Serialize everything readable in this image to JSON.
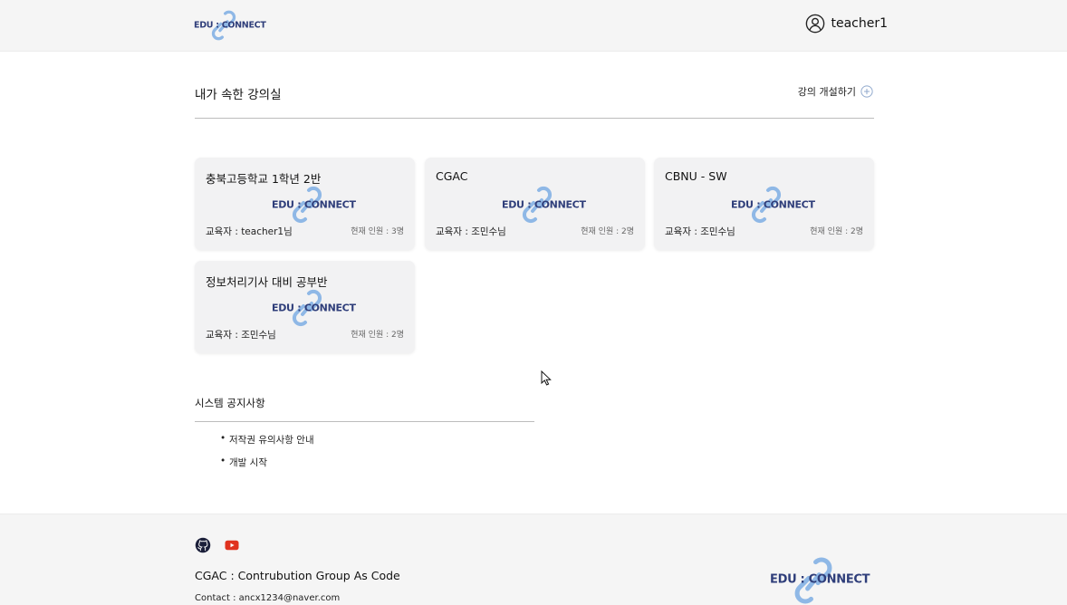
{
  "brand": {
    "logo_text": "EDU : CONNECT",
    "link_color": "#8fb8e6",
    "text_color": "#2f3e7a"
  },
  "header": {
    "username": "teacher1"
  },
  "classrooms": {
    "title": "내가 속한 강의실",
    "create_label": "강의 개설하기",
    "cards": [
      {
        "title": "충북고등학교 1학년 2반",
        "teacher": "교육자 : teacher1님",
        "count": "현재 인원 : 3명"
      },
      {
        "title": "CGAC",
        "teacher": "교육자 : 조민수님",
        "count": "현재 인원 : 2명"
      },
      {
        "title": "CBNU - SW",
        "teacher": "교육자 : 조민수님",
        "count": "현재 인원 : 2명"
      },
      {
        "title": "정보처리기사 대비 공부반",
        "teacher": "교육자 : 조민수님",
        "count": "현재 인원 : 2명"
      }
    ]
  },
  "notices": {
    "title": "시스템 공지사항",
    "items": [
      "저작권 유의사항 안내",
      "개발 시작"
    ]
  },
  "footer": {
    "icons": [
      "github-icon",
      "youtube-icon"
    ],
    "org": "CGAC : Contrubution Group As Code",
    "contact": "Contact : ancx1234@naver.com"
  }
}
